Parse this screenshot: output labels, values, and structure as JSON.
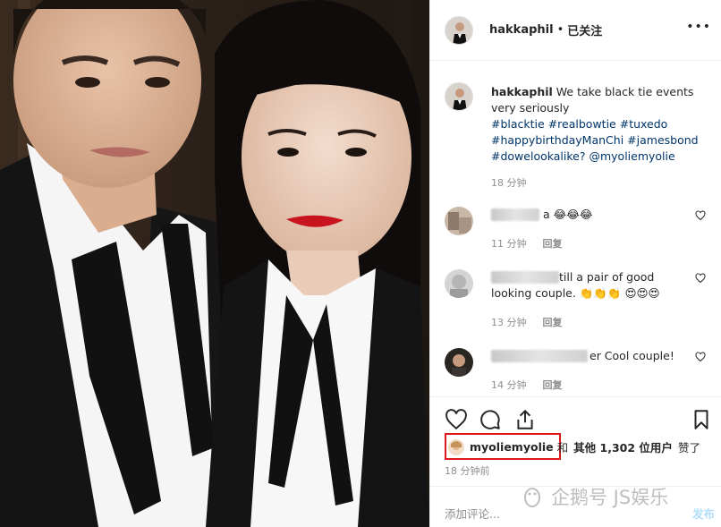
{
  "post": {
    "username": "hakkaphil",
    "separator": "•",
    "follow_status": "已关注",
    "more_icon": "ellipsis-icon"
  },
  "caption": {
    "username": "hakkaphil",
    "text": "We take black tie events very seriously",
    "hashtags": [
      "#blacktie",
      "#realbowtie",
      "#tuxedo",
      "#happybirthdayManChi",
      "#jamesbond",
      "#dowelookalike?"
    ],
    "mention": "@myoliemyolie",
    "time": "18 分钟"
  },
  "comments": [
    {
      "text_visible": "a 😂😂😂",
      "time": "11 分钟",
      "reply": "回复"
    },
    {
      "text_visible": "till a pair of good looking couple. 👏👏👏 😍😍😍",
      "time": "13 分钟",
      "reply": "回复"
    },
    {
      "text_visible": "er Cool couple!",
      "time": "14 分钟",
      "reply": "回复"
    }
  ],
  "likes": {
    "user": "myoliemyolie",
    "and": "和",
    "others": "其他",
    "count": "1,302",
    "suffix": "位用户",
    "liked": "赞了",
    "time": "18 分钟前"
  },
  "add_comment": {
    "placeholder": "添加评论...",
    "post_button": "发布"
  },
  "watermark": {
    "text": "企鹅号 JS娱乐"
  },
  "colors": {
    "accent_link": "#003569",
    "highlight_box": "#e0191f",
    "muted": "#8e8e8e"
  }
}
